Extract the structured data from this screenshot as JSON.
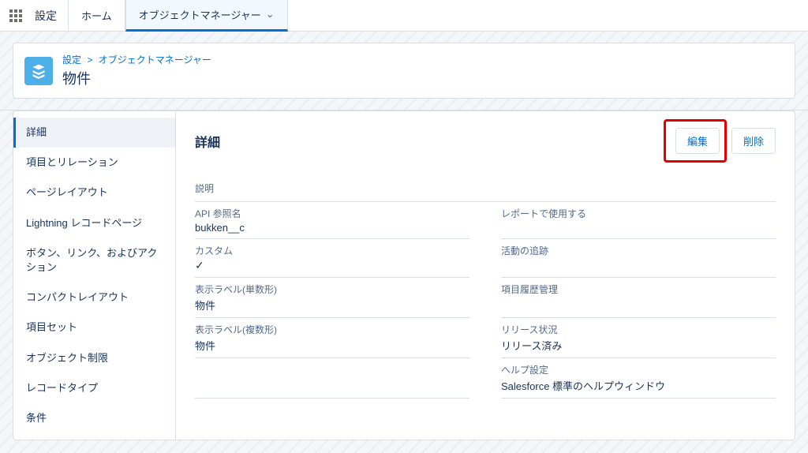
{
  "topnav": {
    "brand": "設定",
    "tabs": [
      {
        "label": "ホーム",
        "active": false
      },
      {
        "label": "オブジェクトマネージャー",
        "active": true,
        "hasDropdown": true
      }
    ]
  },
  "header": {
    "breadcrumb": {
      "root": "設定",
      "sep": ">",
      "current": "オブジェクトマネージャー"
    },
    "title": "物件"
  },
  "sidebar": {
    "items": [
      {
        "label": "詳細",
        "active": true
      },
      {
        "label": "項目とリレーション"
      },
      {
        "label": "ページレイアウト"
      },
      {
        "label": "Lightning レコードページ"
      },
      {
        "label": "ボタン、リンク、およびアクション"
      },
      {
        "label": "コンパクトレイアウト"
      },
      {
        "label": "項目セット"
      },
      {
        "label": "オブジェクト制限"
      },
      {
        "label": "レコードタイプ"
      },
      {
        "label": "条件"
      }
    ]
  },
  "main": {
    "title": "詳細",
    "buttons": {
      "edit": "編集",
      "delete": "削除"
    },
    "fields": {
      "description_label": "説明",
      "api_name_label": "API 参照名",
      "api_name_value": "bukken__c",
      "enable_reports_label": "レポートで使用する",
      "custom_label": "カスタム",
      "custom_value_check": "✓",
      "track_activities_label": "活動の追跡",
      "singular_label_label": "表示ラベル(単数形)",
      "singular_label_value": "物件",
      "track_field_history_label": "項目履歴管理",
      "plural_label_label": "表示ラベル(複数形)",
      "plural_label_value": "物件",
      "deployment_status_label": "リリース状況",
      "deployment_status_value": "リリース済み",
      "help_settings_label": "ヘルプ設定",
      "help_settings_value": "Salesforce 標準のヘルプウィンドウ"
    }
  }
}
